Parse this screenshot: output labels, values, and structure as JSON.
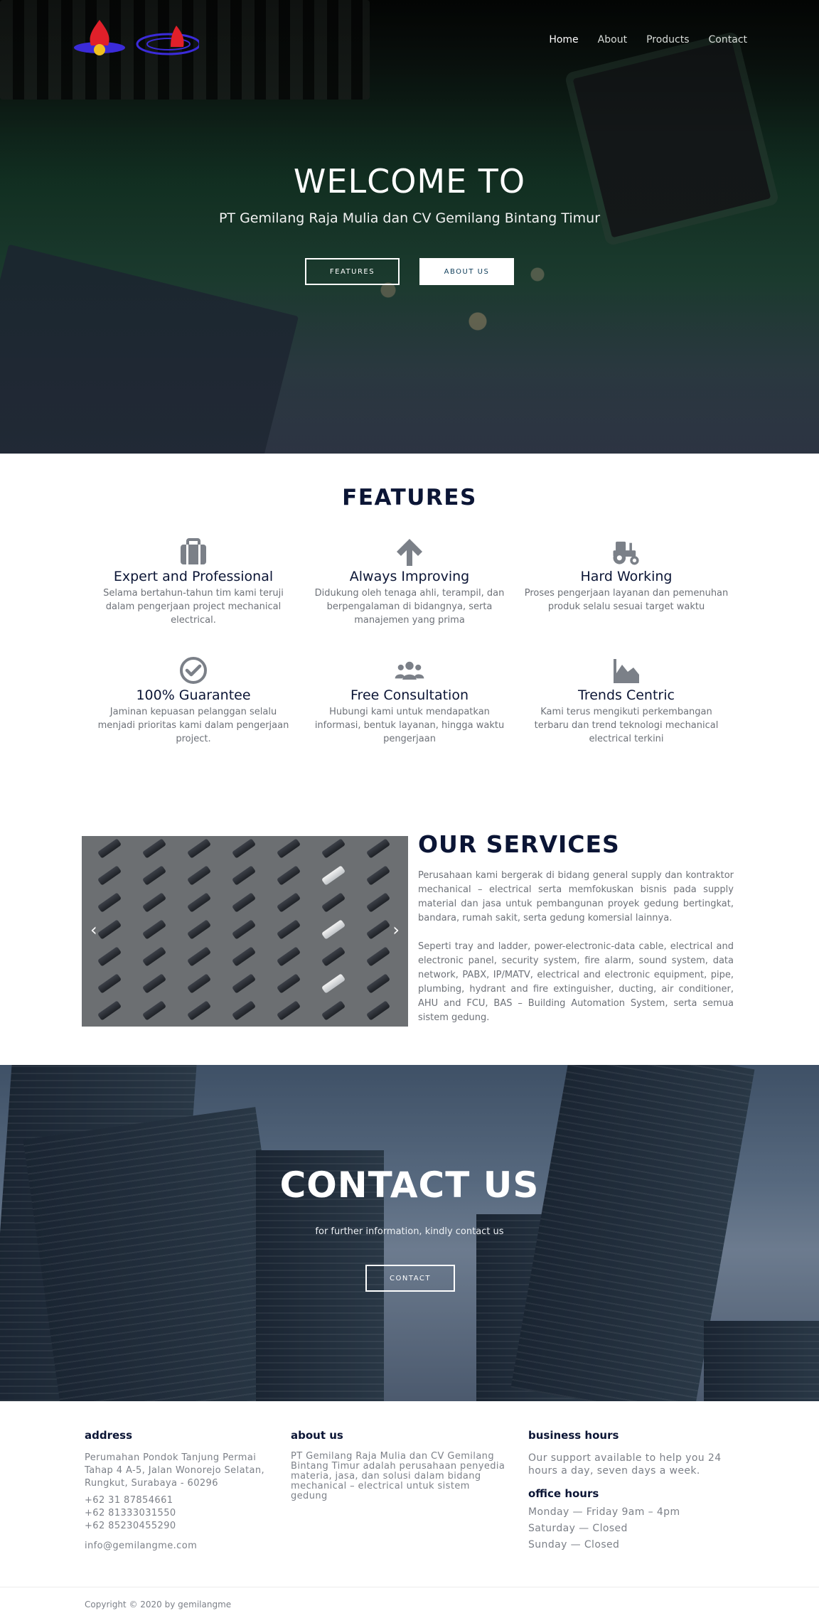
{
  "nav": {
    "items": [
      "Home",
      "About",
      "Products",
      "Contact"
    ]
  },
  "hero": {
    "title": "WELCOME TO",
    "subtitle": "PT Gemilang Raja Mulia dan CV Gemilang Bintang Timur",
    "btn_features": "FEATURES",
    "btn_about": "ABOUT US"
  },
  "features": {
    "title": "FEATURES",
    "items": [
      {
        "icon": "briefcase-icon",
        "title": "Expert and Professional",
        "text": "Selama bertahun-tahun tim kami teruji dalam pengerjaan project mechanical electrical."
      },
      {
        "icon": "arrow-up-icon",
        "title": "Always Improving",
        "text": "Didukung oleh tenaga ahli, terampil, dan berpengalaman di bidangnya, serta manajemen yang prima"
      },
      {
        "icon": "tractor-icon",
        "title": "Hard Working",
        "text": "Proses pengerjaan layanan dan pemenuhan produk selalu sesuai target waktu"
      },
      {
        "icon": "check-circle-icon",
        "title": "100% Guarantee",
        "text": "Jaminan kepuasan pelanggan selalu menjadi prioritas kami dalam pengerjaan project."
      },
      {
        "icon": "users-icon",
        "title": "Free Consultation",
        "text": "Hubungi kami untuk mendapatkan informasi, bentuk layanan, hingga waktu pengerjaan"
      },
      {
        "icon": "chart-area-icon",
        "title": "Trends Centric",
        "text": "Kami terus mengikuti perkembangan terbaru dan trend teknologi mechanical electrical terkini"
      }
    ]
  },
  "services": {
    "title": "OUR SERVICES",
    "p1": "Perusahaan kami bergerak di bidang general supply dan kontraktor mechanical – electrical serta memfokuskan bisnis pada supply material dan jasa untuk pembangunan proyek gedung bertingkat, bandara, rumah sakit, serta gedung komersial lainnya.",
    "p2": "Seperti tray and ladder, power-electronic-data cable, electrical and electronic panel, security system, fire alarm, sound system, data network, PABX, IP/MATV, electrical and electronic equipment, pipe, plumbing, hydrant and fire extinguisher, ducting, air conditioner, AHU and FCU, BAS – Building Automation System, serta semua sistem gedung."
  },
  "contact": {
    "title": "CONTACT US",
    "subtitle": "for further information, kindly contact us",
    "button": "CONTACT"
  },
  "footer": {
    "address_title": "address",
    "address": "Perumahan Pondok Tanjung Permai Tahap 4 A-5, Jalan Wonorejo Selatan, Rungkut, Surabaya - 60296",
    "phones": [
      "+62 31 87854661",
      "+62 81333031550",
      "+62 85230455290"
    ],
    "email": "info@gemilangme.com",
    "about_title": "about us",
    "about_text": "PT Gemilang Raja Mulia dan CV Gemilang Bintang Timur adalah perusahaan penyedia materia, jasa, dan solusi dalam bidang mechanical – electrical untuk sistem gedung",
    "hours_title": "business hours",
    "hours_text": "Our support available to help you 24 hours a day, seven days a week.",
    "office_title": "office hours",
    "office": [
      "Monday — Friday 9am – 4pm",
      "Saturday — Closed",
      "Sunday — Closed"
    ],
    "copyright": "Copyright © 2020 by gemilangme"
  },
  "colors": {
    "heading": "#0b1535",
    "body_text": "#6d7178",
    "icon": "#7b8088"
  }
}
